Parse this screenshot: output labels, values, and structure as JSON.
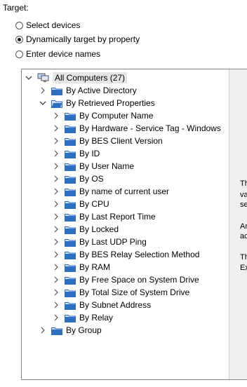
{
  "target": {
    "label": "Target:"
  },
  "radios": [
    {
      "label": "Select devices",
      "checked": false
    },
    {
      "label": "Dynamically target by property",
      "checked": true
    },
    {
      "label": "Enter device names",
      "checked": false
    }
  ],
  "tree": {
    "root": {
      "label": "All Computers (27)"
    },
    "active_directory": {
      "label": "By Active Directory"
    },
    "retrieved": {
      "label": "By Retrieved Properties"
    },
    "children": [
      "By Computer Name",
      "By Hardware - Service Tag - Windows",
      "By BES Client Version",
      "By ID",
      "By User Name",
      "By OS",
      "By name of current user",
      "By CPU",
      "By Last Report Time",
      "By Locked",
      "By Last UDP Ping",
      "By BES Relay Selection Method",
      "By RAM",
      "By Free Space on System Drive",
      "By Total Size of System Drive",
      "By Subnet Address",
      "By Relay"
    ],
    "group": {
      "label": "By Group"
    }
  },
  "right_panel": {
    "lines": [
      "Th",
      "va",
      "se",
      "Ar",
      "ac",
      "Th",
      "Ex"
    ]
  },
  "colors": {
    "folder": "#2f6fc1",
    "folder_light": "#cfe2fb",
    "selection": "#e5e5e5"
  }
}
